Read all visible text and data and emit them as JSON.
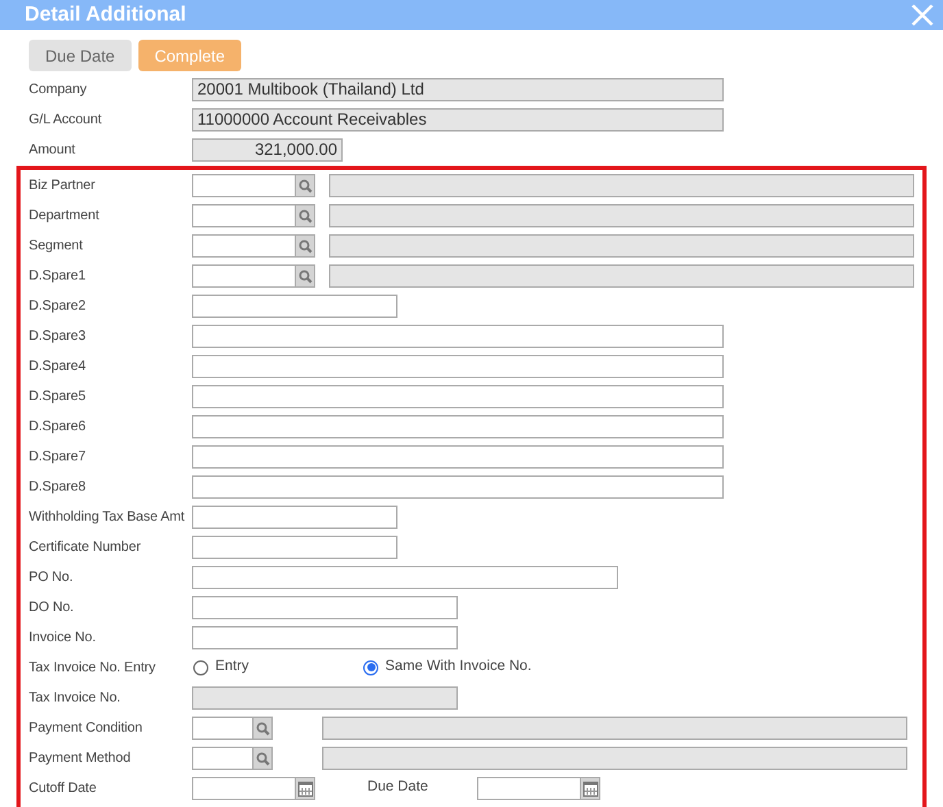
{
  "window": {
    "title": "Detail Additional"
  },
  "buttons": [
    {
      "label": "Due Date",
      "selected": false
    },
    {
      "label": "Complete",
      "selected": true
    }
  ],
  "fields": [
    {
      "label": "Company",
      "kind": "readonly_wide",
      "value": "20001 Multibook (Thailand) Ltd"
    },
    {
      "label": "G/L Account",
      "kind": "readonly_wide",
      "value": "11000000 Account Receivables"
    },
    {
      "label": "Amount",
      "kind": "amount",
      "value": "321,000.00"
    }
  ],
  "highlight_box": {
    "fields": [
      {
        "label": "Biz Partner",
        "kind": "lookup_wide"
      },
      {
        "label": "Department",
        "kind": "lookup_wide"
      },
      {
        "label": "Segment",
        "kind": "lookup_wide"
      },
      {
        "label": "D.Spare1",
        "kind": "lookup_wide"
      },
      {
        "label": "D.Spare2",
        "kind": "text_short"
      },
      {
        "label": "D.Spare3",
        "kind": "text_wide"
      },
      {
        "label": "D.Spare4",
        "kind": "text_wide"
      },
      {
        "label": "D.Spare5",
        "kind": "text_wide"
      },
      {
        "label": "D.Spare6",
        "kind": "text_wide"
      },
      {
        "label": "D.Spare7",
        "kind": "text_wide"
      },
      {
        "label": "D.Spare8",
        "kind": "text_wide"
      },
      {
        "label": "Withholding Tax Base Amt",
        "kind": "text_short"
      },
      {
        "label": "Certificate Number",
        "kind": "text_short"
      },
      {
        "label": "PO No.",
        "kind": "text_long"
      },
      {
        "label": "DO No.",
        "kind": "text_medium"
      },
      {
        "label": "Invoice No.",
        "kind": "text_medium"
      },
      {
        "label": "Tax Invoice No. Entry",
        "kind": "radio",
        "options": [
          {
            "label": "Entry",
            "selected": false
          },
          {
            "label": "Same With Invoice No.",
            "selected": true
          }
        ]
      },
      {
        "label": "Tax Invoice No.",
        "kind": "readonly_medium"
      },
      {
        "label": "Payment Condition",
        "kind": "lookup_narrow"
      },
      {
        "label": "Payment Method",
        "kind": "lookup_narrow"
      },
      {
        "label": "Cutoff Date",
        "kind": "date",
        "second_label": "Due Date"
      }
    ]
  }
}
